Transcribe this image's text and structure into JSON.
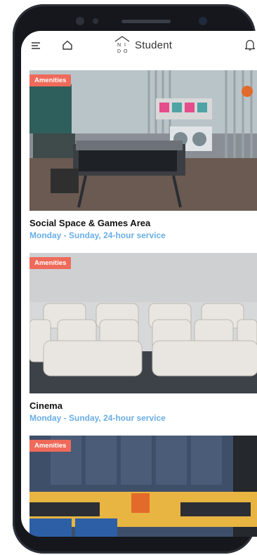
{
  "header": {
    "brand": "Student",
    "logo_letters": [
      "N",
      "I",
      "D",
      "O"
    ],
    "icons": {
      "menu": "hamburger-icon",
      "home": "home-icon",
      "notifications": "bell-icon"
    }
  },
  "cards": [
    {
      "badge": "Amenities",
      "title": "Social Space & Games Area",
      "subtitle": "Monday - Sunday, 24-hour service"
    },
    {
      "badge": "Amenities",
      "title": "Cinema",
      "subtitle": "Monday - Sunday, 24-hour service"
    },
    {
      "badge": "Amenities",
      "title": "",
      "subtitle": ""
    }
  ],
  "colors": {
    "badge": "#ef6a5a",
    "subtitle": "#6aaee4",
    "frame": "#15171c"
  }
}
